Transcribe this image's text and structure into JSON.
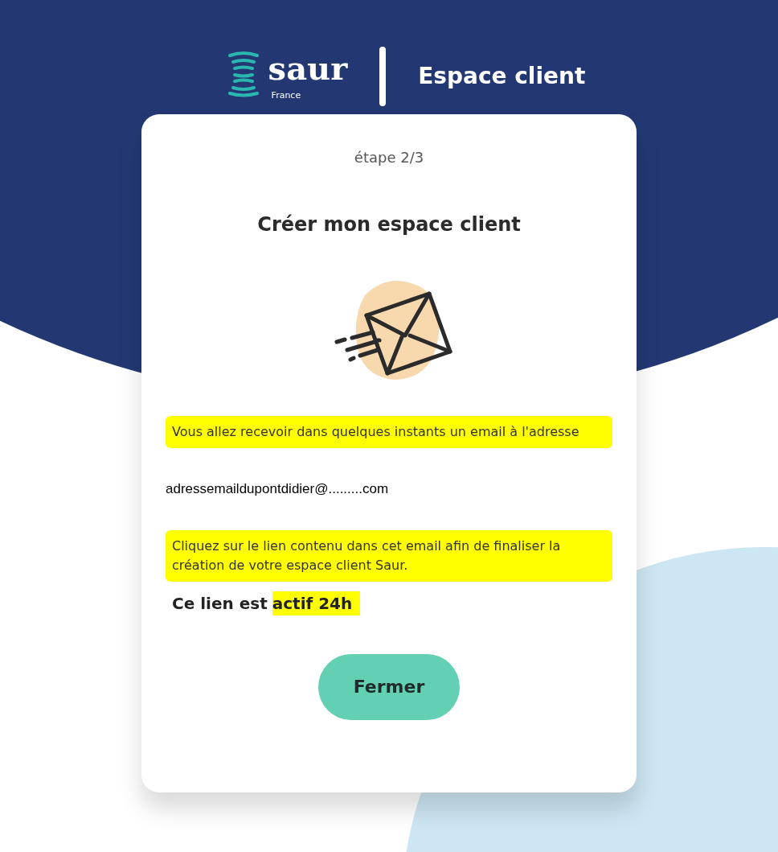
{
  "header": {
    "logo_text": "saur",
    "logo_subtext": "France",
    "title": "Espace client"
  },
  "card": {
    "step": "étape 2/3",
    "title": "Créer mon espace client",
    "paragraphs": [
      {
        "kind": "message",
        "text": "Vous allez recevoir dans quelques instants un email à l'adresse",
        "highlighted": true
      },
      {
        "kind": "email",
        "text": "adressemaildupontdidier@.........com",
        "highlighted": false
      },
      {
        "kind": "message",
        "text": "Cliquez sur le lien contenu dans cet email afin de finaliser la création de votre espace client Saur.",
        "highlighted": true
      }
    ],
    "notice": [
      {
        "text": "Ce lien est",
        "highlighted": false
      },
      {
        "text": "actif 24h",
        "highlighted": true
      }
    ],
    "button": "Fermer"
  }
}
